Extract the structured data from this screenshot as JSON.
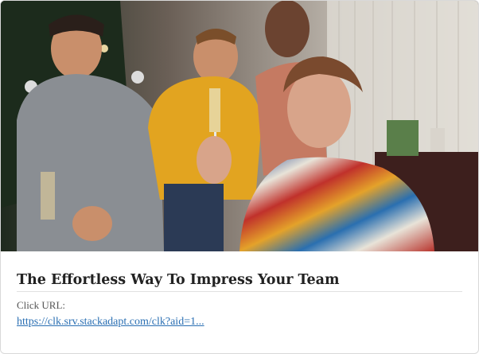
{
  "ad": {
    "image": {
      "description_icon": "photo-party-group"
    },
    "headline": "The Effortless Way To Impress Your Team",
    "click_label": "Click URL:",
    "click_url": "https://clk.srv.stackadapt.com/clk?aid=1..."
  },
  "colors": {
    "link": "#2a6fb3",
    "headline": "#222222",
    "divider": "#e1e1e1"
  }
}
